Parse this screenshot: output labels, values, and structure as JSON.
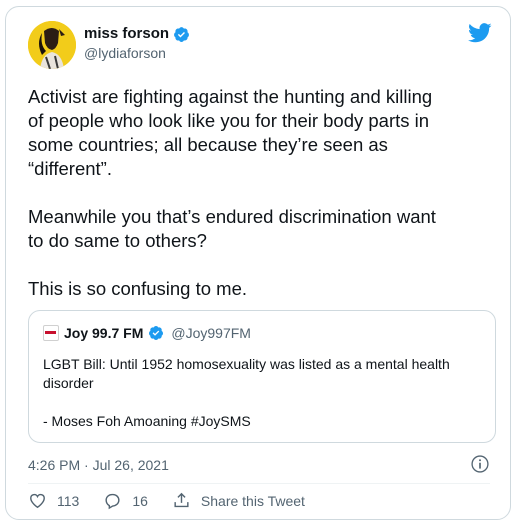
{
  "author": {
    "name": "miss forson",
    "handle": "@lydiaforson",
    "avatar": "avatar-image"
  },
  "tweet": {
    "text": "Activist are fighting against the hunting and killing\nof people who look like you for their body parts in\nsome countries; all because they’re seen as\n“different”.\n\nMeanwhile you that’s endured discrimination want\nto do same to others?\n\nThis is so confusing to me."
  },
  "quote": {
    "name": "Joy 99.7 FM",
    "handle": "@Joy997FM",
    "text": "LGBT Bill: Until 1952 homosexuality was listed as a mental health\ndisorder\n\n- Moses Foh Amoaning #JoySMS"
  },
  "meta": {
    "timestamp": "4:26 PM · Jul 26, 2021"
  },
  "actions": {
    "like_count": "113",
    "reply_count": "16",
    "share_label": "Share this Tweet"
  },
  "colors": {
    "twitter_blue": "#1d9bf0",
    "secondary_text": "#536471",
    "border": "#cfd9de"
  },
  "icons": [
    "twitter-bird-icon",
    "verified-badge-icon",
    "info-icon",
    "heart-icon",
    "reply-icon",
    "share-icon"
  ]
}
